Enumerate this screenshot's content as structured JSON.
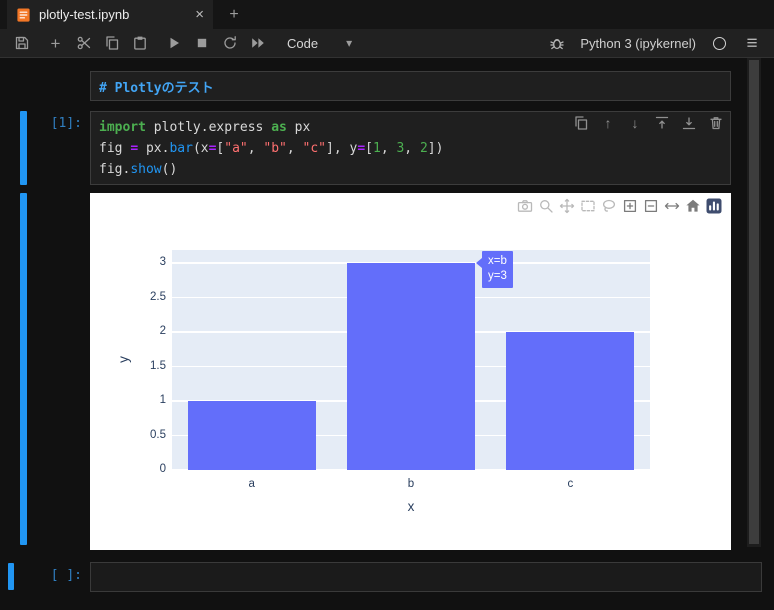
{
  "tab": {
    "title": "plotly-test.ipynb",
    "close_label": "×",
    "new_tab_label": "+"
  },
  "toolbar": {
    "left_icons": [
      "save",
      "add",
      "cut",
      "copy",
      "paste",
      "run",
      "stop",
      "restart",
      "fast-forward"
    ],
    "cell_type": "Code",
    "kernel_name": "Python 3 (ipykernel)"
  },
  "notebook": {
    "markdown_cell": {
      "source": "# Plotlyのテスト"
    },
    "code_cell": {
      "prompt": "[1]:",
      "toolbar_icons": [
        "duplicate",
        "move-up",
        "move-down",
        "insert-above",
        "insert-below",
        "delete"
      ],
      "lines": [
        [
          [
            "kw",
            "import"
          ],
          [
            "pl",
            " plotly.express "
          ],
          [
            "kw",
            "as"
          ],
          [
            "pl",
            " px"
          ]
        ],
        [
          [
            "pl",
            "fig "
          ],
          [
            "op",
            "="
          ],
          [
            "pl",
            " px."
          ],
          [
            "prop",
            "bar"
          ],
          [
            "pl",
            "(x"
          ],
          [
            "op",
            "="
          ],
          [
            "pl",
            "["
          ],
          [
            "str",
            "\"a\""
          ],
          [
            "pl",
            ", "
          ],
          [
            "str",
            "\"b\""
          ],
          [
            "pl",
            ", "
          ],
          [
            "str",
            "\"c\""
          ],
          [
            "pl",
            "], y"
          ],
          [
            "op",
            "="
          ],
          [
            "pl",
            "["
          ],
          [
            "num",
            "1"
          ],
          [
            "pl",
            ", "
          ],
          [
            "num",
            "3"
          ],
          [
            "pl",
            ", "
          ],
          [
            "num",
            "2"
          ],
          [
            "pl",
            "])"
          ]
        ],
        [
          [
            "pl",
            "fig."
          ],
          [
            "prop",
            "show"
          ],
          [
            "pl",
            "()"
          ]
        ]
      ]
    },
    "empty_cell": {
      "prompt": "[ ]:"
    }
  },
  "chart_data": {
    "type": "bar",
    "categories": [
      "a",
      "b",
      "c"
    ],
    "values": [
      1,
      3,
      2
    ],
    "title": "",
    "xlabel": "x",
    "ylabel": "y",
    "yticks": [
      0,
      0.5,
      1,
      1.5,
      2,
      2.5,
      3
    ],
    "ylim": [
      0,
      3.19
    ],
    "grid": true,
    "legend": false,
    "bar_color": "#636EFA",
    "plot_bgcolor": "#E5ECF6",
    "tooltip": {
      "category": "b",
      "lines": [
        "x=b",
        "y=3"
      ]
    },
    "modebar_icons": [
      "camera",
      "zoom",
      "pan",
      "box-select",
      "lasso",
      "zoom-in",
      "zoom-out",
      "autoscale",
      "home",
      "plotly-logo"
    ]
  }
}
